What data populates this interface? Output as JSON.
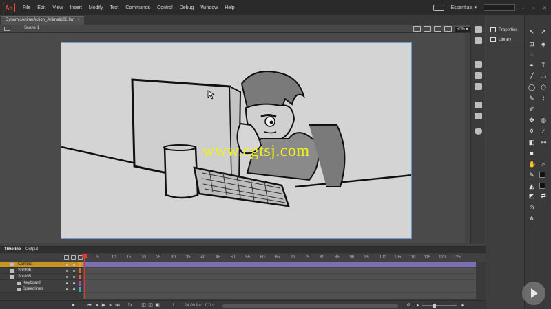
{
  "app": {
    "logo": "An"
  },
  "menu": [
    "File",
    "Edit",
    "View",
    "Insert",
    "Modify",
    "Text",
    "Commands",
    "Control",
    "Debug",
    "Window",
    "Help"
  ],
  "workspace": "Essentials",
  "document": {
    "tab_title": "DynamicAnimeAction_Animatic08.fla*",
    "close": "×"
  },
  "scene": {
    "label": "Scene 1",
    "zoom": "50%"
  },
  "stage": {
    "watermark": "www.cgtsj.com",
    "background": "#d4d4d4"
  },
  "properties": {
    "tabs": [
      "Properties",
      "Library"
    ]
  },
  "timeline": {
    "tabs": [
      "Timeline",
      "Output"
    ],
    "ruler": [
      "1",
      "5",
      "10",
      "15",
      "20",
      "25",
      "30",
      "35",
      "40",
      "45",
      "50",
      "55",
      "60",
      "65",
      "70",
      "75",
      "80",
      "85",
      "90",
      "95",
      "100",
      "105",
      "110",
      "115",
      "120",
      "125"
    ],
    "layers": [
      {
        "name": "Camera",
        "active": true,
        "color": "#e0a020"
      },
      {
        "name": "Shot06",
        "active": false,
        "color": "#e06a20"
      },
      {
        "name": "Shot05",
        "active": false,
        "color": "#e06a20"
      },
      {
        "name": "Keyboard",
        "active": false,
        "color": "#c040c0"
      },
      {
        "name": "Speedlines",
        "active": false,
        "color": "#30b0b0"
      }
    ],
    "current_frame": "1",
    "fps": "24.00 fps",
    "time": "0.0 s"
  },
  "colors": {
    "accent_layer": "#c89224",
    "playhead": "#e0393a",
    "camera_frames": "#7e6fb3"
  }
}
